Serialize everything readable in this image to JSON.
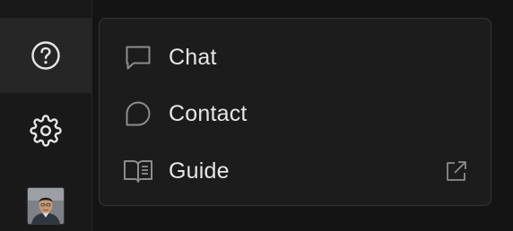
{
  "sidebar": {
    "help_icon": "help-circle-icon",
    "settings_icon": "gear-icon",
    "avatar": "user-avatar"
  },
  "menu": {
    "items": [
      {
        "label": "Chat",
        "icon": "chat-bubble-icon"
      },
      {
        "label": "Contact",
        "icon": "speech-bubble-icon"
      },
      {
        "label": "Guide",
        "icon": "book-open-icon",
        "trailing_icon": "external-link-icon"
      }
    ]
  },
  "colors": {
    "background": "#141414",
    "sidebar": "#191919",
    "active_item": "#262626",
    "menu_bg": "#1c1c1c",
    "menu_border": "#363636",
    "text": "#e6e6e6",
    "icon": "#8c8c8c"
  }
}
